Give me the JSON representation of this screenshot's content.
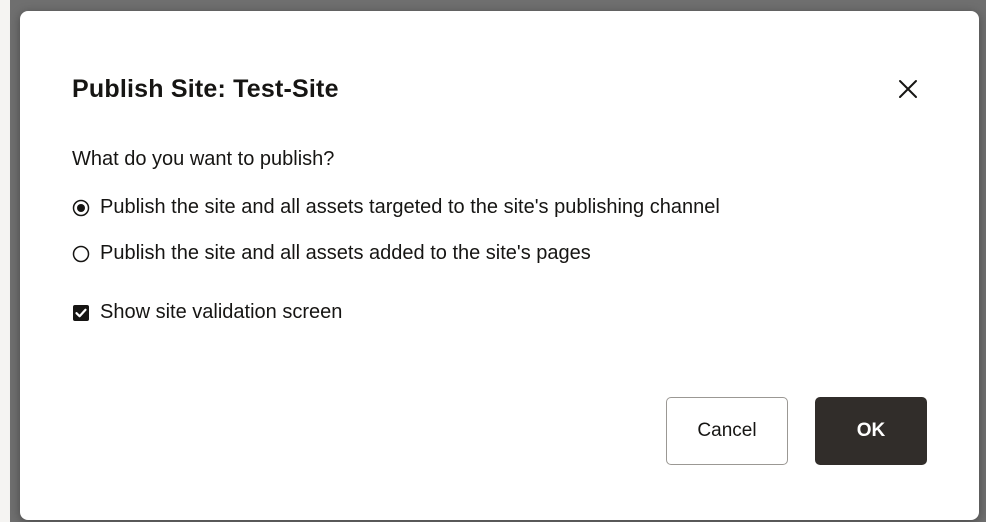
{
  "dialog": {
    "title": "Publish Site: Test-Site",
    "question": "What do you want to publish?",
    "options": [
      {
        "label": "Publish the site and all assets targeted to the site's publishing channel",
        "selected": true
      },
      {
        "label": "Publish the site and all assets added to the site's pages",
        "selected": false
      }
    ],
    "validation": {
      "label": "Show site validation screen",
      "checked": true
    },
    "buttons": {
      "cancel": "Cancel",
      "ok": "OK"
    },
    "icons": {
      "close": "close-icon",
      "radio_on": "radio-selected-icon",
      "radio_off": "radio-unselected-icon",
      "checkbox": "checkbox-checked-icon"
    },
    "colors": {
      "primary_button": "#312d2a",
      "text": "#161513",
      "overlay": "#6f6f6f"
    }
  }
}
